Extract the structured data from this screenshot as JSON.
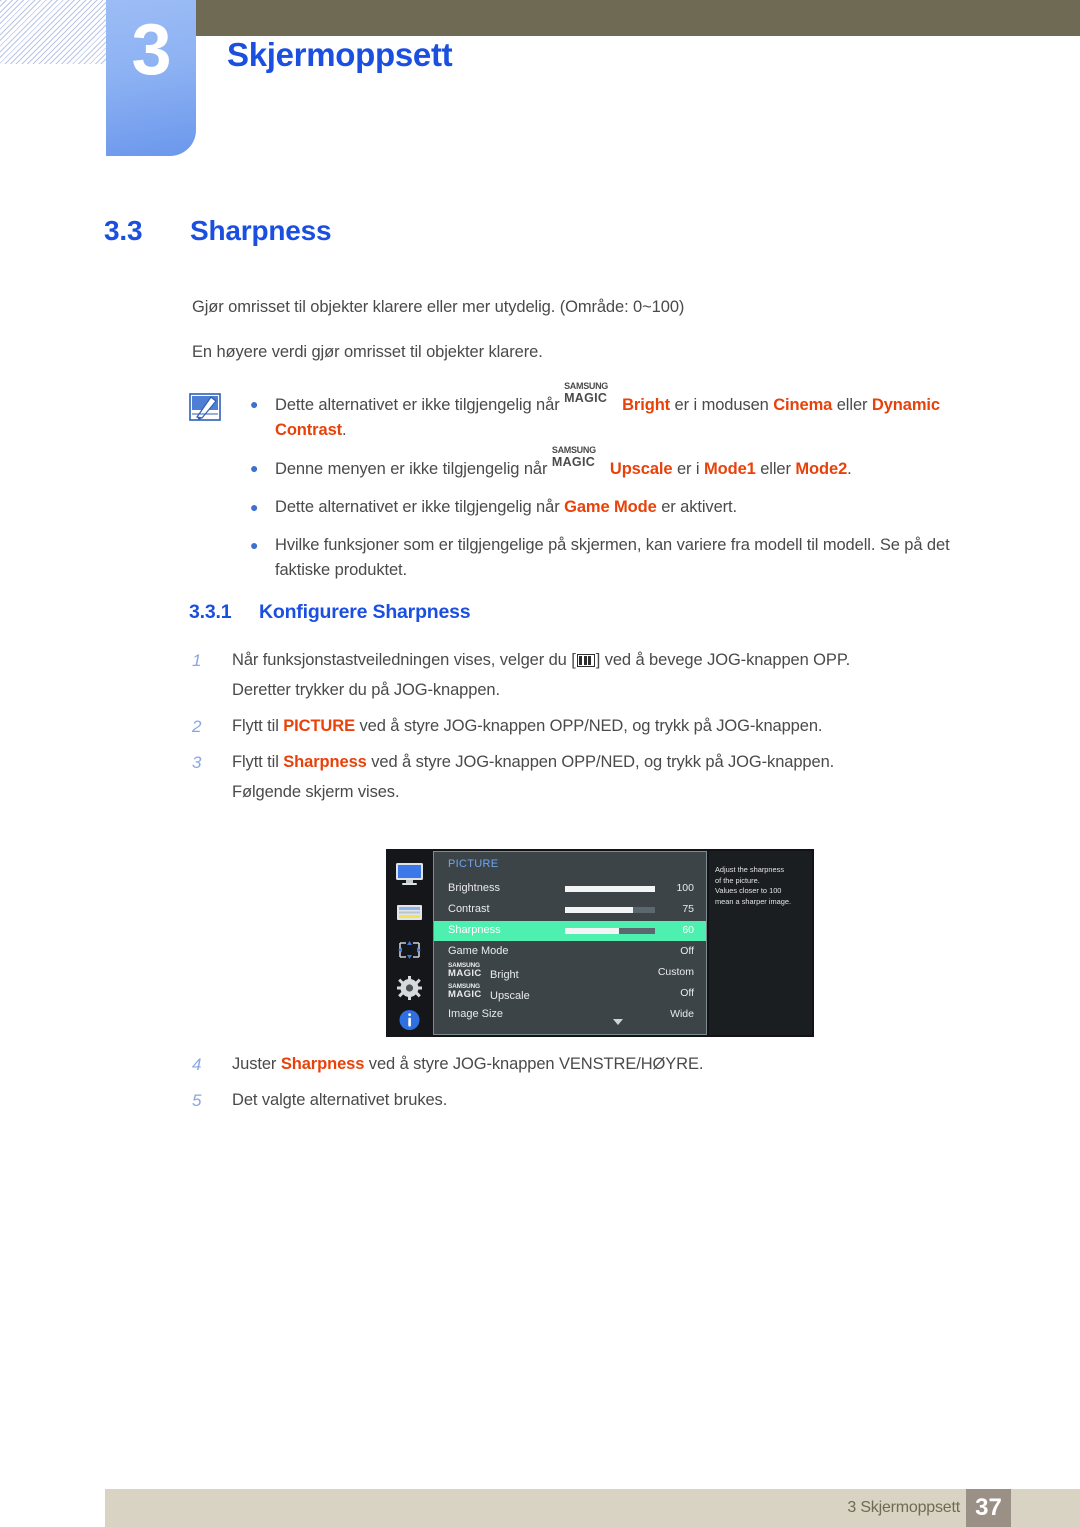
{
  "header": {
    "chapter_number": "3",
    "chapter_title": "Skjermoppsett"
  },
  "section": {
    "number": "3.3",
    "title": "Sharpness"
  },
  "intro": {
    "paragraph1": "Gjør omrisset til objekter klarere eller mer utydelig. (Område: 0~100)",
    "paragraph2": "En høyere verdi gjør omrisset til objekter klarere."
  },
  "note": {
    "icon": "note-pen-icon",
    "items": [
      {
        "t1": "Dette alternativet er ikke tilgjengelig når ",
        "magic_top": "SAMSUNG",
        "magic_bottom": "MAGIC",
        "hi1": "Bright",
        "t2": " er i modusen ",
        "hi2": "Cinema",
        "t3": " eller ",
        "hi3": "Dynamic Contrast",
        "t4": "."
      },
      {
        "t1": "Denne menyen er ikke tilgjengelig når ",
        "magic_top": "SAMSUNG",
        "magic_bottom": "MAGIC",
        "hi1": "Upscale",
        "t2": " er i ",
        "hi2": "Mode1",
        "t3": " eller ",
        "hi3": "Mode2",
        "t4": "."
      },
      {
        "t1": "Dette alternativet er ikke tilgjengelig når ",
        "hi2": "Game Mode",
        "t3": " er aktivert."
      },
      {
        "t1": "Hvilke funksjoner som er tilgjengelige på skjermen, kan variere fra modell til modell. Se på det faktiske produktet."
      }
    ]
  },
  "subsection": {
    "number": "3.3.1",
    "title": "Konfigurere Sharpness"
  },
  "steps": [
    {
      "n": "1",
      "t1": "Når funksjonstastveiledningen vises, velger du [",
      "icon": "menu-glyph-icon",
      "t2": "] ved å bevege JOG-knappen OPP.",
      "sub": "Deretter trykker du på JOG-knappen."
    },
    {
      "n": "2",
      "t1": "Flytt til ",
      "hi": "PICTURE",
      "t2": " ved å styre JOG-knappen OPP/NED, og trykk på JOG-knappen."
    },
    {
      "n": "3",
      "t1": "Flytt til ",
      "hi": "Sharpness",
      "t2": " ved å styre JOG-knappen OPP/NED, og trykk på JOG-knappen.",
      "sub": "Følgende skjerm vises."
    },
    {
      "n": "4",
      "t1": "Juster ",
      "hi": "Sharpness",
      "t2": " ved å styre JOG-knappen VENSTRE/HØYRE."
    },
    {
      "n": "5",
      "t1": "Det valgte alternativet brukes."
    }
  ],
  "osd": {
    "title": "PICTURE",
    "sidebar_icons": [
      "monitor-icon",
      "list-icon",
      "move-arrows-icon",
      "gear-icon",
      "info-icon"
    ],
    "rows": [
      {
        "label": "Brightness",
        "value": "100",
        "slider": 100,
        "selected": false
      },
      {
        "label": "Contrast",
        "value": "75",
        "slider": 75,
        "selected": false
      },
      {
        "label": "Sharpness",
        "value": "60",
        "slider": 60,
        "selected": true
      },
      {
        "label": "Game Mode",
        "value": "Off",
        "slider": null,
        "selected": false
      }
    ],
    "magic_rows": [
      {
        "top": "SAMSUNG",
        "bottom": "MAGIC",
        "label": "Bright",
        "value": "Custom"
      },
      {
        "top": "SAMSUNG",
        "bottom": "MAGIC",
        "label": "Upscale",
        "value": "Off"
      }
    ],
    "last_row": {
      "label": "Image Size",
      "value": "Wide"
    },
    "tooltip": [
      "Adjust the sharpness",
      "of the picture.",
      "Values closer to 100",
      "mean a sharper image."
    ],
    "scroll_arrow": "chevron-down-icon"
  },
  "footer": {
    "text": "3 Skjermoppsett",
    "page": "37"
  },
  "colors": {
    "accent_blue": "#1a4fe0",
    "highlight_red": "#e8420a",
    "olive": "#6e6a53",
    "footer_beige": "#d8d3c2",
    "osd_selected_green": "#4ef0af"
  }
}
